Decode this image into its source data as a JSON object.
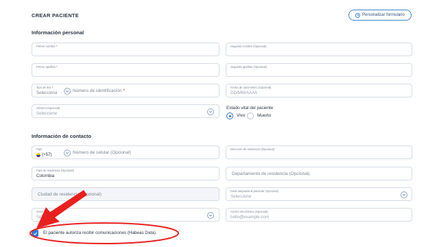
{
  "header": {
    "title": "CREAR PACIENTE",
    "customize_label": "Personalizar formulario"
  },
  "sections": {
    "personal": "Información personal",
    "contact": "Información de contacto"
  },
  "fields": {
    "first_name": {
      "label": "Primer nombre",
      "required": "*"
    },
    "middle_name": {
      "label": "Segundo nombre (Opcional)"
    },
    "first_surname": {
      "label": "Primer apellido",
      "required": "*"
    },
    "second_surname": {
      "label": "Segundo apellido (Opcional)"
    },
    "doc_type": {
      "label": "Tipo de doc",
      "required": "*",
      "value": "Selecciona"
    },
    "id_number": {
      "label": "Número de identificación",
      "required": "*"
    },
    "birth_date": {
      "label": "Fecha de nacimiento (Opcional)",
      "placeholder": "DD/MM/AAAA"
    },
    "gender": {
      "label": "Género (Opcional)",
      "value": "Seleccione"
    },
    "country_code": {
      "label": "País",
      "value": "(+57)"
    },
    "phone": {
      "label": "Número de celular (Opcional)"
    },
    "address": {
      "label": "Dirección de residencia (Opcional)"
    },
    "country": {
      "label": "País de residencia (Opcional)",
      "value": "Colombia"
    },
    "department": {
      "label": "Departamento de residencia (Opcional)"
    },
    "city": {
      "label": "Ciudad de residencia (Opcional)"
    },
    "branch": {
      "label": "Sede asignada al paciente (Opcional)",
      "value": "Seleccione"
    },
    "zone": {
      "label": "Zona",
      "required": "*",
      "value": "Sel"
    },
    "email": {
      "label": "Correo electrónico (Opcional)",
      "placeholder": "hello@example.com"
    }
  },
  "vital_status": {
    "label": "Estado vital del paciente",
    "options": [
      "Vivo",
      "Muerto"
    ],
    "selected": "Vivo"
  },
  "consent": {
    "label": "El paciente autoriza recibir comunicaciones (Habeas Data).",
    "checked": true
  },
  "annotation": {
    "arrow_color": "#e8201e",
    "ellipse_color": "#e8201e"
  },
  "colors": {
    "accent": "#2f7bd6",
    "border": "#d5dbe3",
    "required": "#e02424"
  },
  "icons": [
    "gear-icon",
    "chevron-down-icon",
    "check-icon",
    "colombia-flag-icon"
  ]
}
